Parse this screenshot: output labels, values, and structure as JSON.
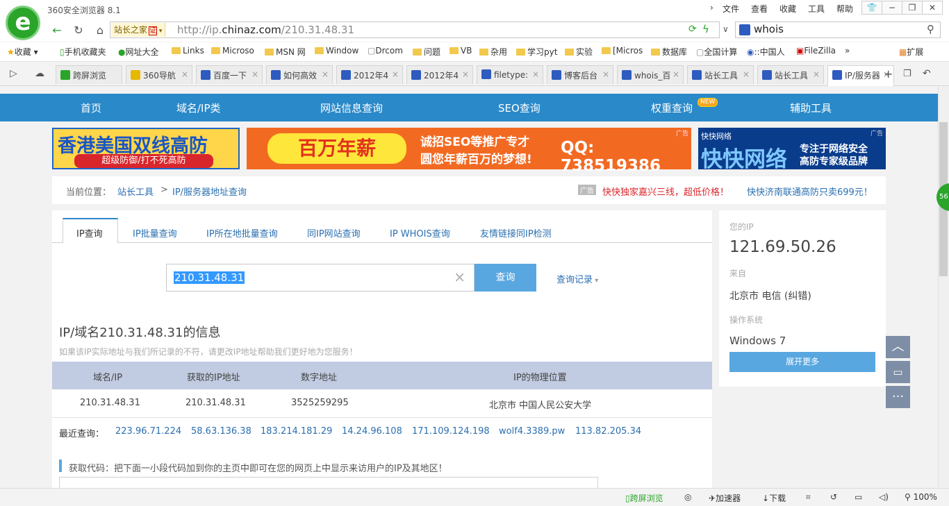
{
  "browser": {
    "app_title": "360安全浏览器 8.1",
    "menus": [
      "文件",
      "查看",
      "收藏",
      "工具",
      "帮助"
    ],
    "site_badge": "站长之家",
    "cert": "证",
    "url_prefix": "http://ip.",
    "url_domain": "chinaz.com",
    "url_path": "/210.31.48.31",
    "search_text": "whois",
    "bookmarks": [
      "收藏",
      "手机收藏夹",
      "网址大全",
      "Links",
      "Microso",
      "MSN 网",
      "Window",
      "Drcom",
      "问题",
      "VB",
      "杂用",
      "学习pyt",
      "实验",
      "[Micros",
      "数据库",
      "全国计算",
      "::中国人",
      "FileZilla",
      "扩展"
    ],
    "tabs": [
      "跨屏浏览",
      "360导航",
      "百度一下",
      "如何高效",
      "2012年4",
      "2012年4",
      "filetype:",
      "博客后台",
      "whois_百",
      "站长工具",
      "站长工具",
      "IP/服务器"
    ],
    "status": {
      "cross": "跨屏浏览",
      "accel": "加速器",
      "download": "下载",
      "zoom": "100%"
    }
  },
  "nav": {
    "items": [
      "首页",
      "域名/IP类",
      "网站信息查询",
      "SEO查询",
      "权重查询",
      "辅助工具"
    ],
    "new_badge": "NEW"
  },
  "ads": {
    "ad1_title": "香港美国双线高防",
    "ad1_sub": "超级防御/打不死高防",
    "ad2_big": "百万年薪",
    "ad2_line1": "诚招SEO等推广专才",
    "ad2_line2": "圆您年薪百万的梦想!",
    "ad2_qq": "QQ: 738519386",
    "ad3_brand": "快快网络",
    "ad3_big": "快快网络",
    "ad3_line1": "专注于网络安全",
    "ad3_line2": "高防专家级品牌",
    "tag": "广告"
  },
  "breadcrumb": {
    "label": "当前位置：",
    "home": "站长工具",
    "sep": ">",
    "current": "IP/服务器地址查询",
    "promo_tag": "广告",
    "promo1": "快快独家嘉兴三线，超低价格！",
    "promo2": "快快济南联通高防只卖699元！"
  },
  "query": {
    "tabs": [
      "IP查询",
      "IP批量查询",
      "IP所在地批量查询",
      "同IP网站查询",
      "IP WHOIS查询",
      "友情链接同IP检测"
    ],
    "input_value": "210.31.48.31",
    "button": "查询",
    "history": "查询记录"
  },
  "result": {
    "title": "IP/域名210.31.48.31的信息",
    "sub_before": "如果该IP实际地址与我们所记录的不符，请",
    "sub_link": "更改IP地址",
    "sub_after": "帮助我们更好地为您服务！",
    "headers": [
      "域名/IP",
      "获取的IP地址",
      "数字地址",
      "IP的物理位置"
    ],
    "row": [
      "210.31.48.31",
      "210.31.48.31",
      "3525259295",
      "北京市 中国人民公安大学"
    ],
    "recent_label": "最近查询：",
    "recent": [
      "223.96.71.224",
      "58.63.136.38",
      "183.214.181.29",
      "14.24.96.108",
      "171.109.124.198",
      "wolf4.3389.pw",
      "113.82.205.34"
    ],
    "code_title": "获取代码：把下面一小段代码加到你的主页中即可在您的网页上中显示来访用户的IP及其地区！"
  },
  "side": {
    "ip_label": "您的IP",
    "ip": "121.69.50.26",
    "from_label": "来自",
    "from": "北京市 电信",
    "from_link": "(纠错)",
    "os_label": "操作系统",
    "os": "Windows 7",
    "more": "展开更多"
  },
  "green_ball": "56"
}
